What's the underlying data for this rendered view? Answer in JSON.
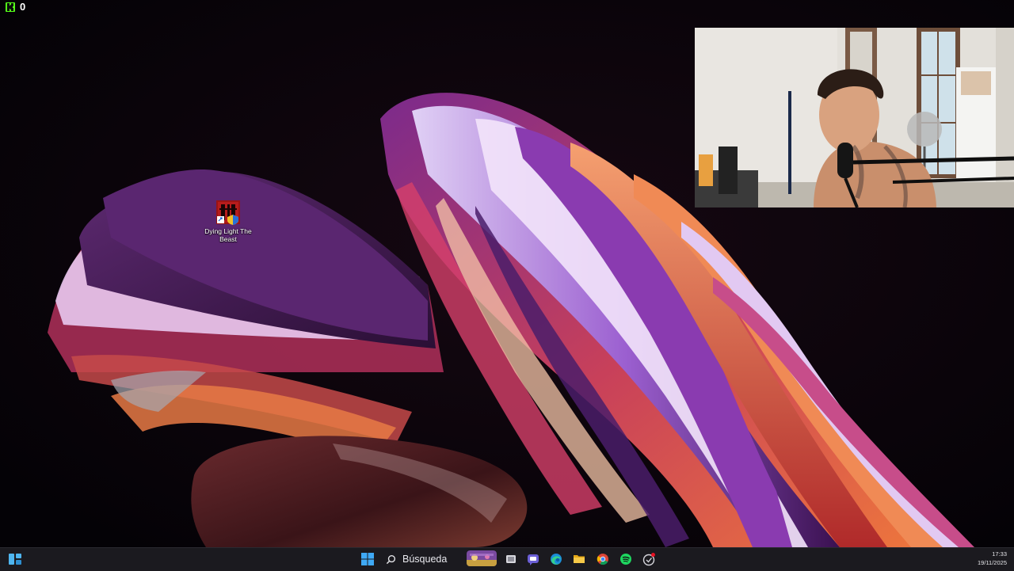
{
  "stream_overlay": {
    "viewer_count": "0",
    "logo_icon": "kick-logo-icon",
    "accent": "#53fc18"
  },
  "desktop": {
    "icons": [
      {
        "label": "Dying Light The Beast",
        "icon": "dying-light-game-icon"
      }
    ]
  },
  "webcam": {
    "description_icon": "webcam-feed"
  },
  "taskbar": {
    "widgets_icon": "widgets-icon",
    "start_icon": "windows-start-icon",
    "search_placeholder": "Búsqueda",
    "search_icon": "search-icon",
    "pinned": [
      "task-view-icon",
      "teams-chat-icon",
      "edge-icon",
      "file-explorer-icon",
      "chrome-icon",
      "spotify-icon",
      "app-with-notification-icon"
    ],
    "clock": {
      "time": "17:33",
      "date": "19/11/2025"
    }
  }
}
